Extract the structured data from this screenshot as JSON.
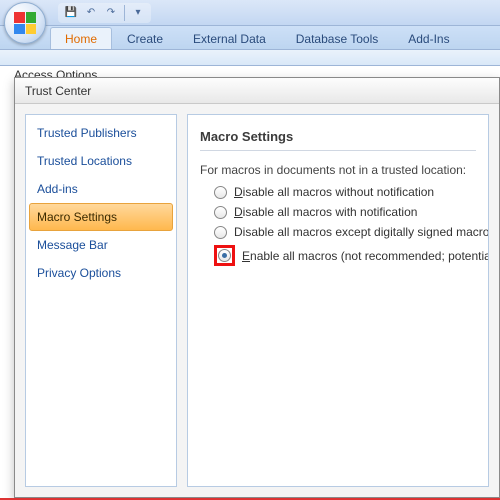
{
  "qat": {
    "save": "💾",
    "undo": "↶",
    "redo": "↷",
    "more": "▾"
  },
  "ribbon": {
    "tabs": [
      {
        "label": "Home",
        "active": true
      },
      {
        "label": "Create"
      },
      {
        "label": "External Data"
      },
      {
        "label": "Database Tools"
      },
      {
        "label": "Add-Ins"
      }
    ]
  },
  "background_dialog_title": "Access Options",
  "dialog": {
    "title": "Trust Center",
    "categories": [
      "Trusted Publishers",
      "Trusted Locations",
      "Add-ins",
      "Macro Settings",
      "Message Bar",
      "Privacy Options"
    ],
    "active_category_index": 3,
    "panel": {
      "heading": "Macro Settings",
      "intro": "For macros in documents not in a trusted location:",
      "options": [
        {
          "text": "Disable all macros without notification",
          "u": "D"
        },
        {
          "text": "isable all macros with notification",
          "u": "D"
        },
        {
          "text": "Disable all macros except digitally signed macros",
          "u": "g"
        },
        {
          "text": "nable all macros (not recommended; potentially dan",
          "u": "E"
        }
      ],
      "selected_index": 3,
      "highlight_index": 3
    }
  }
}
